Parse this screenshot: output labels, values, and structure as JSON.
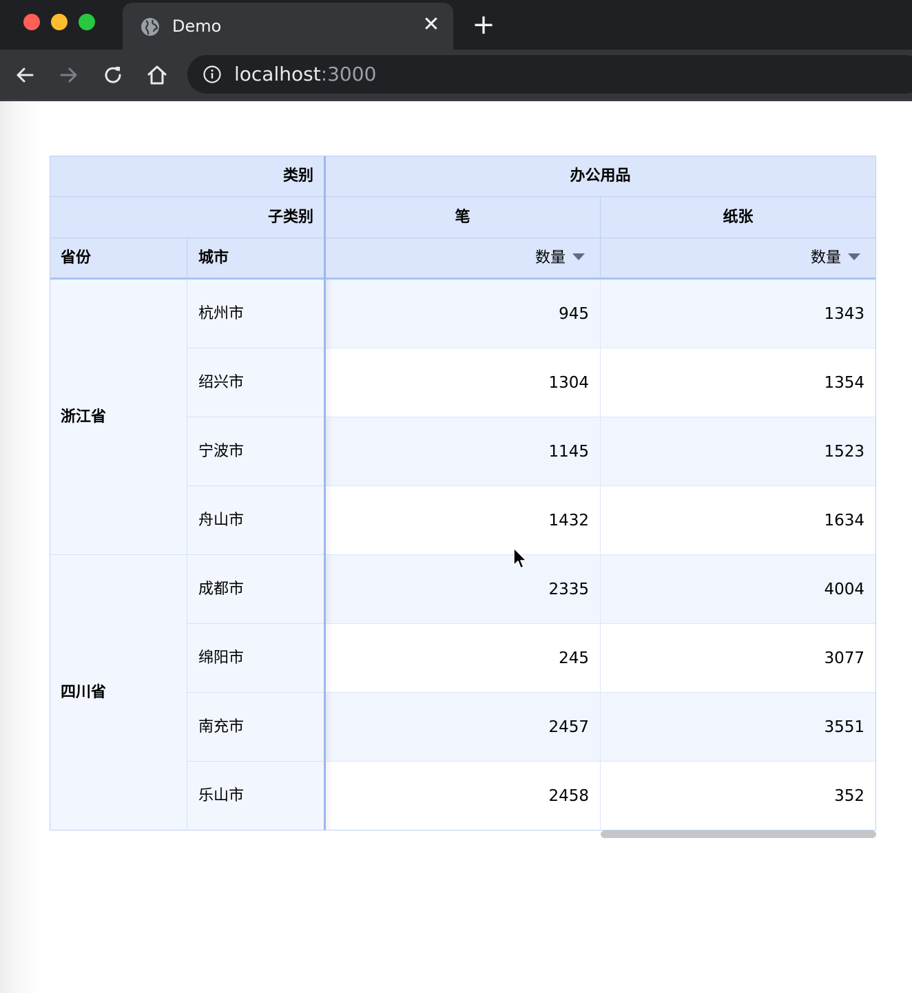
{
  "browser": {
    "tab_title": "Demo",
    "url_host": "localhost",
    "url_port": ":3000"
  },
  "pivot": {
    "col_dim_labels": [
      "类别",
      "子类别"
    ],
    "row_dim_labels": [
      "省份",
      "城市"
    ],
    "category": "办公用品",
    "subcategories": [
      "笔",
      "纸张"
    ],
    "measure_label": "数量",
    "provinces": [
      {
        "name": "浙江省",
        "cities": [
          {
            "name": "杭州市",
            "values": [
              945,
              1343
            ]
          },
          {
            "name": "绍兴市",
            "values": [
              1304,
              1354
            ]
          },
          {
            "name": "宁波市",
            "values": [
              1145,
              1523
            ]
          },
          {
            "name": "舟山市",
            "values": [
              1432,
              1634
            ]
          }
        ]
      },
      {
        "name": "四川省",
        "cities": [
          {
            "name": "成都市",
            "values": [
              2335,
              4004
            ]
          },
          {
            "name": "绵阳市",
            "values": [
              245,
              3077
            ]
          },
          {
            "name": "南充市",
            "values": [
              2457,
              3551
            ]
          },
          {
            "name": "乐山市",
            "values": [
              2458,
              352
            ]
          }
        ]
      }
    ]
  }
}
